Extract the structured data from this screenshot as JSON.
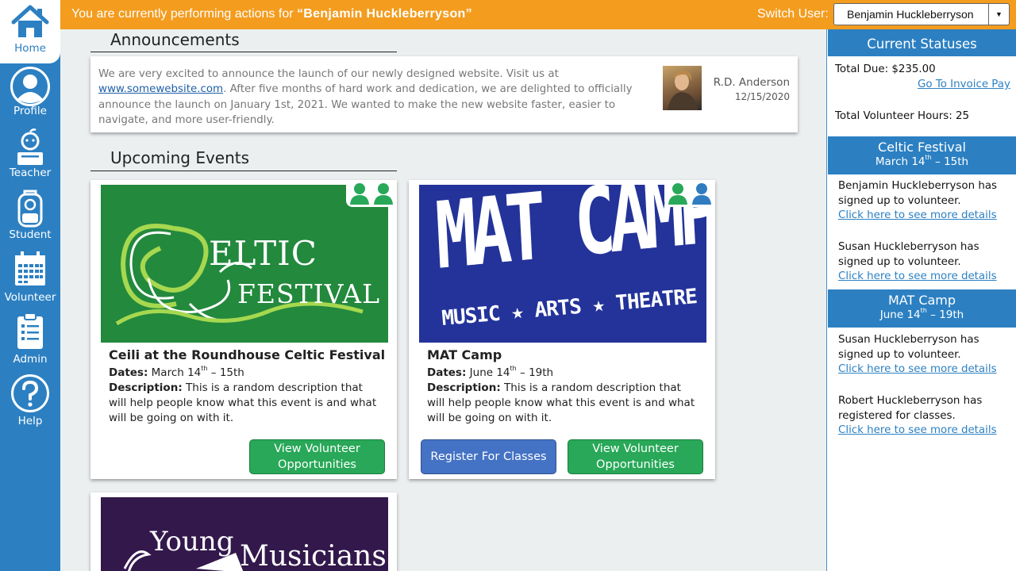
{
  "sidebar": {
    "items": [
      {
        "label": "Home",
        "icon": "home-icon"
      },
      {
        "label": "Profile",
        "icon": "profile-icon"
      },
      {
        "label": "Teacher",
        "icon": "teacher-icon"
      },
      {
        "label": "Student",
        "icon": "student-icon"
      },
      {
        "label": "Volunteer",
        "icon": "calendar-icon"
      },
      {
        "label": "Admin",
        "icon": "clipboard-icon"
      },
      {
        "label": "Help",
        "icon": "help-icon"
      }
    ],
    "active": "Home"
  },
  "topbar": {
    "message_prefix": "You are currently  performing actions for",
    "user_quoted": "“Benjamin  Huckleberryson”",
    "switch_label": "Switch User:",
    "switch_value": "Benjamin Huckleberryson"
  },
  "announcements": {
    "heading": "Announcements",
    "text_1": "We are very excited to announce the launch of our newly designed website. Visit us at ",
    "link": "www.somewebsite.com",
    "text_2": ".  After five months of hard work and dedication, we are delighted to officially announce the launch on January 1st, 2021. We wanted to make the new website faster, easier to navigate, and more user-friendly.",
    "author": "R.D. Anderson",
    "date": "12/15/2020"
  },
  "events": {
    "heading": "Upcoming Events",
    "dates_key": "Dates:",
    "desc_key": "Description:",
    "items": [
      {
        "title": "Ceili at the Roundhouse Celtic Festival",
        "dates_a": " March 14",
        "sup_a": "th",
        "dates_b": " – 15th",
        "description": " This is a random description that will help people know  what this event is and what will be going on with it.",
        "image_text_1": "ELTIC",
        "image_text_2": "FESTIVAL",
        "buttons": [
          "View Volunteer Opportunities"
        ]
      },
      {
        "title": "MAT Camp",
        "dates_a": " June 14",
        "sup_a": "th",
        "dates_b": " – 19th",
        "description": " This is a random description that will help people know  what this event is and what will be going on with it.",
        "image_text_1": "MAT CAMP",
        "image_text_2": "MUSIC ★ ARTS ★ THEATRE",
        "buttons": [
          "Register For Classes",
          "View Volunteer Opportunities"
        ]
      },
      {
        "image_text_1": "Young",
        "image_text_2": "Musicians"
      }
    ]
  },
  "statuses": {
    "heading": "Current Statuses",
    "total_due": "Total Due: $235.00",
    "invoice_link": "Go To Invoice Pay",
    "volunteer_hours": "Total Volunteer Hours: 25",
    "groups": [
      {
        "title": "Celtic Festival",
        "dates_a": "March 14",
        "sup": "th",
        "dates_b": " – 15th",
        "entries": [
          {
            "text": "Benjamin Huckleberryson has signed up to volunteer.",
            "link": "Click here to see more  details"
          },
          {
            "text": "Susan Huckleberryson has signed up to volunteer.",
            "link": "Click here to see more  details"
          }
        ]
      },
      {
        "title": "MAT Camp",
        "dates_a": "June 14",
        "sup": "th",
        "dates_b": " – 19th",
        "entries": [
          {
            "text": "Susan Huckleberryson has signed up to volunteer.",
            "link": "Click here to see more  details"
          },
          {
            "text": "Robert Huckleberryson has registered for classes.",
            "link": "Click here to see more  details"
          }
        ]
      }
    ]
  },
  "colors": {
    "sidebar": "#2c80c2",
    "topbar": "#f39c1e",
    "green_button": "#28a858",
    "blue_button": "#4472c4",
    "celtic_bg": "#23893d",
    "mat_bg": "#23339a",
    "young_bg": "#33184c"
  }
}
